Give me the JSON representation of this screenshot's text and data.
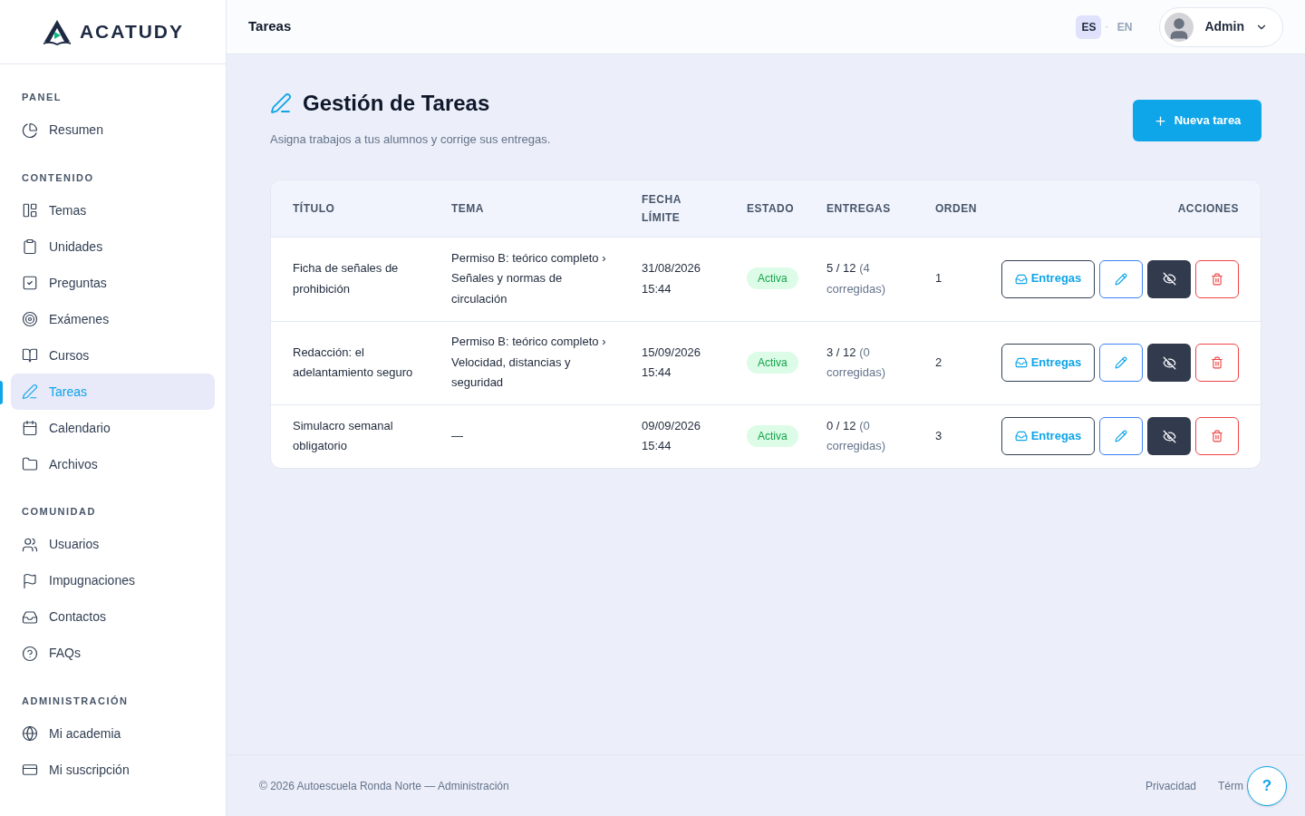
{
  "brand": {
    "name": "ACATUDY"
  },
  "header": {
    "title": "Tareas",
    "language_separator": "·",
    "languages": [
      {
        "label": "ES",
        "selected": true
      },
      {
        "label": "EN",
        "selected": false
      }
    ],
    "user": "Admin"
  },
  "sidebar": {
    "sections": [
      {
        "title": "PANEL",
        "items": [
          {
            "label": "Resumen",
            "selected": false
          }
        ]
      },
      {
        "title": "CONTENIDO",
        "items": [
          {
            "label": "Temas",
            "selected": false
          },
          {
            "label": "Unidades",
            "selected": false
          },
          {
            "label": "Preguntas",
            "selected": false
          },
          {
            "label": "Exámenes",
            "selected": false
          },
          {
            "label": "Cursos",
            "selected": false
          },
          {
            "label": "Tareas",
            "selected": true
          },
          {
            "label": "Calendario",
            "selected": false
          },
          {
            "label": "Archivos",
            "selected": false
          }
        ]
      },
      {
        "title": "COMUNIDAD",
        "items": [
          {
            "label": "Usuarios",
            "selected": false
          },
          {
            "label": "Impugnaciones",
            "selected": false
          },
          {
            "label": "Contactos",
            "selected": false
          },
          {
            "label": "FAQs",
            "selected": false
          }
        ]
      },
      {
        "title": "ADMINISTRACIÓN",
        "items": [
          {
            "label": "Mi academia",
            "selected": false
          },
          {
            "label": "Mi suscripción",
            "selected": false
          }
        ]
      }
    ]
  },
  "page": {
    "title": "Gestión de Tareas",
    "subtitle": "Asigna trabajos a tus alumnos y corrige sus entregas.",
    "new_button": "Nueva tarea"
  },
  "table": {
    "columns": [
      "TÍTULO",
      "TEMA",
      "FECHA LÍMITE",
      "ESTADO",
      "ENTREGAS",
      "ORDEN",
      "ACCIONES"
    ],
    "rows": [
      {
        "title": "Ficha de señales de prohibición",
        "topic": "Permiso B: teórico completo › Señales y normas de circulación",
        "due": "31/08/2026 15:44",
        "status": "Activa",
        "submissions": "5 / 12",
        "corrected": "(4 corregidas)",
        "order": "1",
        "submissions_button": "Entregas"
      },
      {
        "title": "Redacción: el adelantamiento seguro",
        "topic": "Permiso B: teórico completo › Velocidad, distancias y seguridad",
        "due": "15/09/2026 15:44",
        "status": "Activa",
        "submissions": "3 / 12",
        "corrected": "(0 corregidas)",
        "order": "2",
        "submissions_button": "Entregas"
      },
      {
        "title": "Simulacro semanal obligatorio",
        "topic": "—",
        "due": "09/09/2026 15:44",
        "status": "Activa",
        "submissions": "0 / 12",
        "corrected": "(0 corregidas)",
        "order": "3",
        "submissions_button": "Entregas"
      }
    ]
  },
  "footer": {
    "copyright": "© 2026 Autoescuela Ronda Norte — Administración",
    "links": [
      "Privacidad",
      "Térm"
    ],
    "help": "?"
  }
}
